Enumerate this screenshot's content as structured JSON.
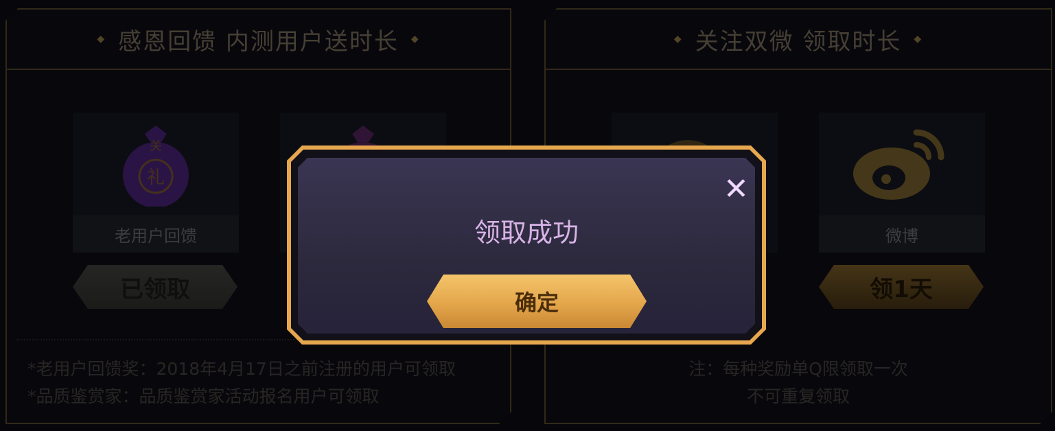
{
  "left_panel": {
    "title": "感恩回馈 内测用户送时长",
    "cards": [
      {
        "label": "老用户回馈",
        "icon": "gift-bag-icon",
        "button": "已领取"
      }
    ],
    "notes": [
      "*老用户回馈奖：2018年4月17日之前注册的用户可领取",
      "*品质鉴赏家：品质鉴赏家活动报名用户可领取"
    ]
  },
  "right_panel": {
    "title": "关注双微 领取时长",
    "cards": [
      {
        "label": "微博",
        "icon": "weibo-icon",
        "button": "领1天"
      }
    ],
    "notes": [
      "注：每种奖励单Q限领取一次",
      "不可重复领取"
    ]
  },
  "modal": {
    "title": "领取成功",
    "confirm_label": "确定",
    "close_icon": "close-icon"
  },
  "colors": {
    "gold": "#e6a74e",
    "modal_title": "#d7b3e6",
    "panel_border": "#4c3f25"
  }
}
